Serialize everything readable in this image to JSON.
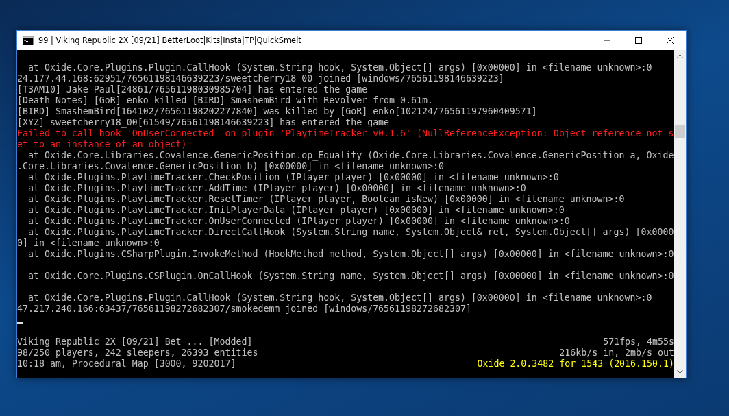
{
  "window": {
    "title": "99 | Viking Republic 2X [09/21] BetterLoot|Kits|Insta|TP|QuickSmelt"
  },
  "console": {
    "lines": [
      {
        "kind": "text",
        "text": "  at Oxide.Core.Plugins.Plugin.CallHook (System.String hook, System.Object[] args) [0x00000] in <filename unknown>:0"
      },
      {
        "kind": "text",
        "text": "24.177.44.168:62951/76561198146639223/sweetcherry18_00 joined [windows/76561198146639223]"
      },
      {
        "kind": "text",
        "text": "[T3AM10] Jake Paul[24861/76561198030985704] has entered the game"
      },
      {
        "kind": "text",
        "text": "[Death Notes] [GoR] enko killed [BIRD] SmashemBird with Revolver from 0.61m."
      },
      {
        "kind": "text",
        "text": "[BIRD] SmashemBird[164102/76561198202277840] was killed by [GoR] enko[102124/76561197960409571]"
      },
      {
        "kind": "text",
        "text": "[XYZ] sweetcherry18_00[61549/76561198146639223] has entered the game"
      },
      {
        "kind": "error",
        "text": "Failed to call hook 'OnUserConnected' on plugin 'PlaytimeTracker v0.1.6' (NullReferenceException: Object reference not s"
      },
      {
        "kind": "error",
        "text": "et to an instance of an object)"
      },
      {
        "kind": "text",
        "text": "  at Oxide.Core.Libraries.Covalence.GenericPosition.op_Equality (Oxide.Core.Libraries.Covalence.GenericPosition a, Oxide"
      },
      {
        "kind": "text",
        "text": ".Core.Libraries.Covalence.GenericPosition b) [0x00000] in <filename unknown>:0"
      },
      {
        "kind": "text",
        "text": "  at Oxide.Plugins.PlaytimeTracker.CheckPosition (IPlayer player) [0x00000] in <filename unknown>:0"
      },
      {
        "kind": "text",
        "text": "  at Oxide.Plugins.PlaytimeTracker.AddTime (IPlayer player) [0x00000] in <filename unknown>:0"
      },
      {
        "kind": "text",
        "text": "  at Oxide.Plugins.PlaytimeTracker.ResetTimer (IPlayer player, Boolean isNew) [0x00000] in <filename unknown>:0"
      },
      {
        "kind": "text",
        "text": "  at Oxide.Plugins.PlaytimeTracker.InitPlayerData (IPlayer player) [0x00000] in <filename unknown>:0"
      },
      {
        "kind": "text",
        "text": "  at Oxide.Plugins.PlaytimeTracker.OnUserConnected (IPlayer player) [0x00000] in <filename unknown>:0"
      },
      {
        "kind": "text",
        "text": "  at Oxide.Plugins.PlaytimeTracker.DirectCallHook (System.String name, System.Object& ret, System.Object[] args) [0x0000"
      },
      {
        "kind": "text",
        "text": "0] in <filename unknown>:0"
      },
      {
        "kind": "text",
        "text": "  at Oxide.Plugins.CSharpPlugin.InvokeMethod (HookMethod method, System.Object[] args) [0x00000] in <filename unknown>:0"
      },
      {
        "kind": "blank"
      },
      {
        "kind": "text",
        "text": "  at Oxide.Core.Plugins.CSPlugin.OnCallHook (System.String name, System.Object[] args) [0x00000] in <filename unknown>:0"
      },
      {
        "kind": "blank"
      },
      {
        "kind": "text",
        "text": "  at Oxide.Core.Plugins.Plugin.CallHook (System.String hook, System.Object[] args) [0x00000] in <filename unknown>:0"
      },
      {
        "kind": "text",
        "text": "47.217.240.166:63437/76561198272682307/smokedemm joined [windows/76561198272682307]"
      },
      {
        "kind": "cursor"
      },
      {
        "kind": "blank"
      }
    ]
  },
  "status_lines": [
    {
      "left": "Viking Republic 2X [09/21] Bet ... [Modded]",
      "right": "571fps, 4m55s",
      "highlighted": false
    },
    {
      "left": "98/250 players, 242 sleepers, 26393 entities",
      "right": "216kb/s in, 2mb/s out",
      "highlighted": false
    },
    {
      "left": "10:18 am, Procedural Map [3000, 9202017]",
      "right": "Oxide 2.0.3482 for 1543 (2016.150.1)",
      "highlighted": true
    }
  ]
}
